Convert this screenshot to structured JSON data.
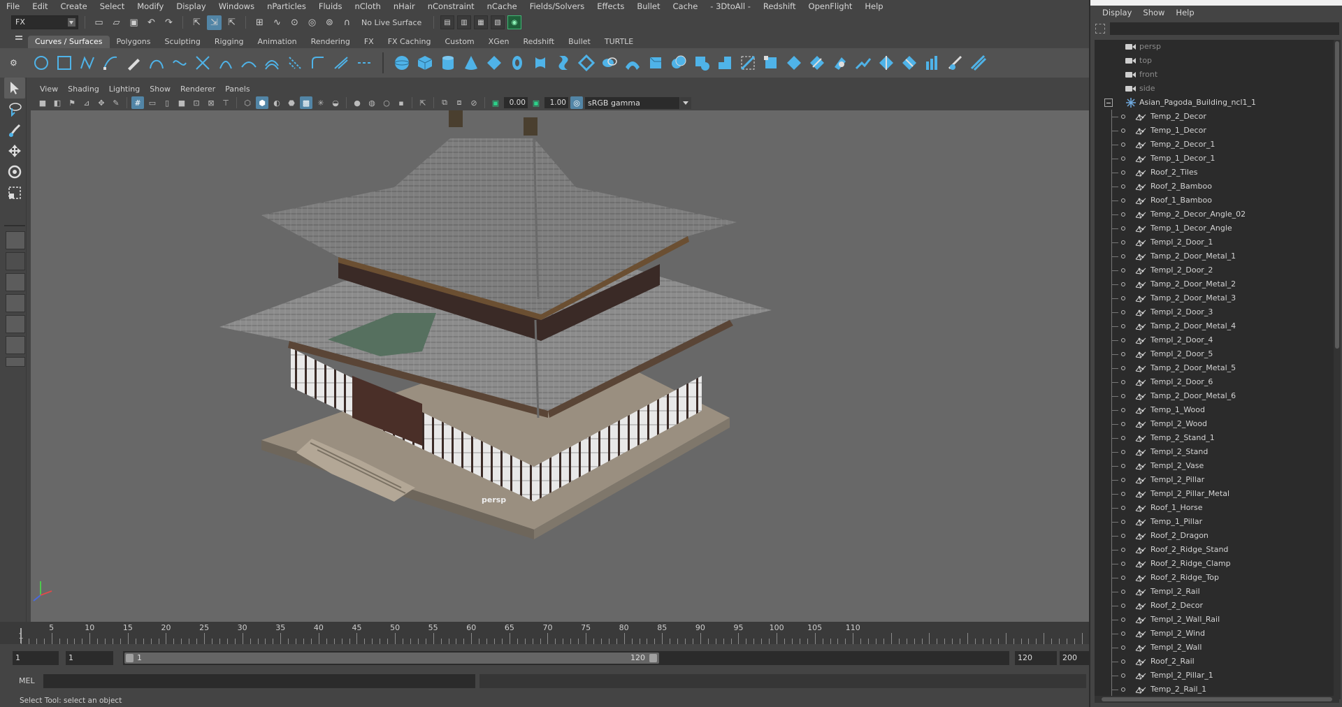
{
  "menubar": {
    "items": [
      "File",
      "Edit",
      "Create",
      "Select",
      "Modify",
      "Display",
      "Windows",
      "nParticles",
      "Fluids",
      "nCloth",
      "nHair",
      "nConstraint",
      "nCache",
      "Fields/Solvers",
      "Effects",
      "Bullet",
      "Cache",
      "- 3DtoAll -",
      "Redshift",
      "OpenFlight",
      "Help"
    ]
  },
  "statusline": {
    "mode": "FX",
    "live_surface": "No Live Surface"
  },
  "shelf": {
    "tabs": [
      "Curves / Surfaces",
      "Polygons",
      "Sculpting",
      "Rigging",
      "Animation",
      "Rendering",
      "FX",
      "FX Caching",
      "Custom",
      "XGen",
      "Redshift",
      "Bullet",
      "TURTLE"
    ],
    "active_tab": "Curves / Surfaces"
  },
  "panel": {
    "menu": [
      "View",
      "Shading",
      "Lighting",
      "Show",
      "Renderer",
      "Panels"
    ],
    "exposure": "0.00",
    "gamma": "1.00",
    "colorspace": "sRGB gamma",
    "camera_label": "persp"
  },
  "timeline": {
    "ticks": [
      1,
      5,
      10,
      15,
      20,
      25,
      30,
      35,
      40,
      45,
      50,
      55,
      60,
      65,
      70,
      75,
      80,
      85,
      90,
      95,
      100,
      105,
      110
    ],
    "current_frame": "1"
  },
  "range": {
    "start": "1",
    "anim_start": "1",
    "range_start_label": "1",
    "range_end_label": "120",
    "end": "120",
    "anim_end": "200"
  },
  "cmdline": {
    "lang": "MEL"
  },
  "helpline": {
    "text": "Select Tool: select an object"
  },
  "outliner": {
    "menu": [
      "Display",
      "Show",
      "Help"
    ],
    "cameras": [
      "persp",
      "top",
      "front",
      "side"
    ],
    "group": "Asian_Pagoda_Building_ncl1_1",
    "children": [
      "Temp_2_Decor",
      "Temp_1_Decor",
      "Temp_2_Decor_1",
      "Temp_1_Decor_1",
      "Roof_2_Tiles",
      "Roof_2_Bamboo",
      "Roof_1_Bamboo",
      "Temp_2_Decor_Angle_02",
      "Temp_1_Decor_Angle",
      "Templ_2_Door_1",
      "Tamp_2_Door_Metal_1",
      "Templ_2_Door_2",
      "Tamp_2_Door_Metal_2",
      "Tamp_2_Door_Metal_3",
      "Templ_2_Door_3",
      "Tamp_2_Door_Metal_4",
      "Templ_2_Door_4",
      "Templ_2_Door_5",
      "Tamp_2_Door_Metal_5",
      "Templ_2_Door_6",
      "Tamp_2_Door_Metal_6",
      "Temp_1_Wood",
      "Templ_2_Wood",
      "Temp_2_Stand_1",
      "Templ_2_Stand",
      "Templ_2_Vase",
      "Templ_2_Pillar",
      "Templ_2_Pillar_Metal",
      "Roof_1_Horse",
      "Temp_1_Pillar",
      "Roof_2_Dragon",
      "Roof_2_Ridge_Stand",
      "Roof_2_Ridge_Clamp",
      "Roof_2_Ridge_Top",
      "Templ_2_Rail",
      "Roof_2_Decor",
      "Templ_2_Wall_Rail",
      "Templ_2_Wind",
      "Templ_2_Wall",
      "Roof_2_Rail",
      "Templ_2_Pillar_1",
      "Temp_2_Rail_1"
    ]
  },
  "colors": {
    "accent_blue": "#5285a6",
    "shelf_icon_blue": "#4fb3e8",
    "viewport_bg": "#686868"
  }
}
